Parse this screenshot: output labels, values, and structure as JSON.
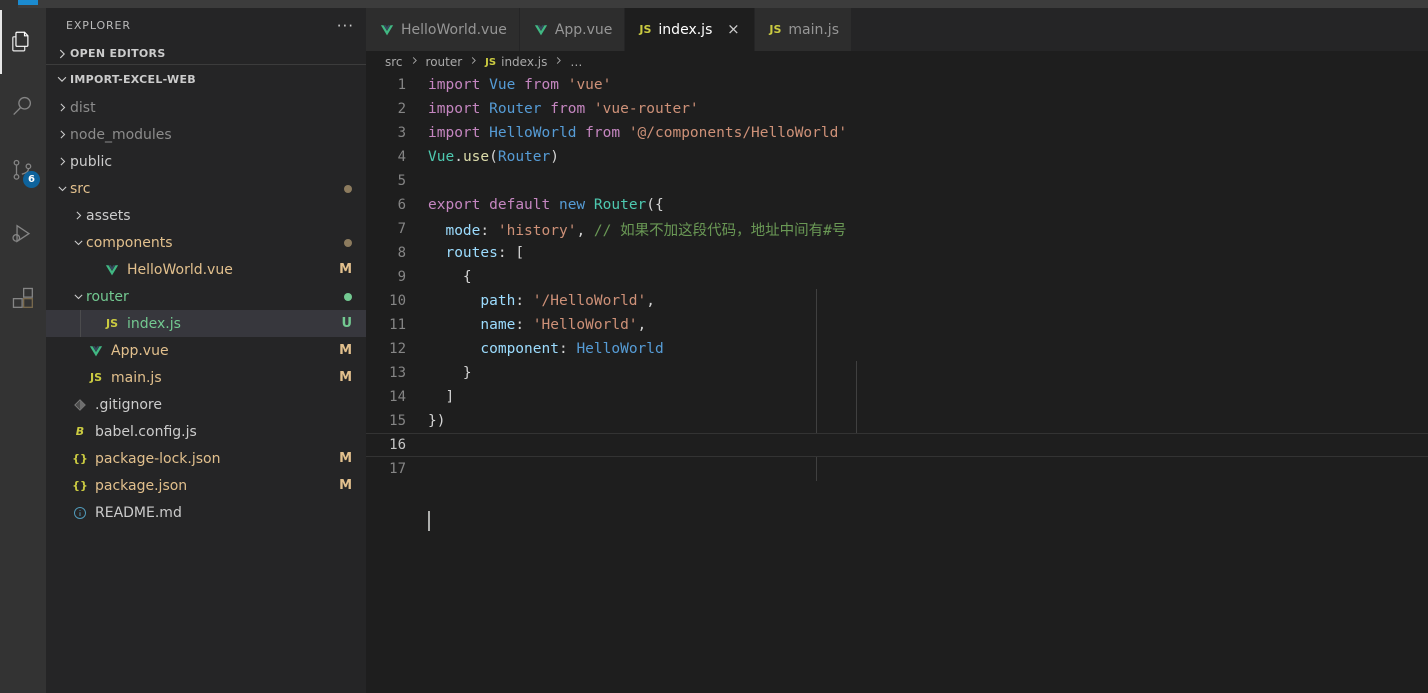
{
  "window": {
    "accent_color": "#1b8bd0",
    "chrome_bg": "#3c3c3c"
  },
  "activity_bar": {
    "items": [
      {
        "name": "explorer-icon",
        "label": "Explorer",
        "active": true,
        "badge": ""
      },
      {
        "name": "search-icon",
        "label": "Search",
        "active": false,
        "badge": ""
      },
      {
        "name": "source-control-icon",
        "label": "Source Control",
        "active": false,
        "badge": "6"
      },
      {
        "name": "run-and-debug-icon",
        "label": "Run and Debug",
        "active": false,
        "badge": ""
      },
      {
        "name": "extensions-icon",
        "label": "Extensions",
        "active": false,
        "badge": ""
      }
    ]
  },
  "sidebar": {
    "title": "EXPLORER",
    "more_actions": "···",
    "sections": [
      {
        "label": "OPEN EDITORS",
        "expanded": false
      },
      {
        "label": "IMPORT-EXCEL-WEB",
        "expanded": true
      }
    ],
    "tree": [
      {
        "label": "dist",
        "depth": 1,
        "type": "folder",
        "expanded": false,
        "deco": "",
        "dot": "",
        "color": "#8c8c8c",
        "icon": ""
      },
      {
        "label": "node_modules",
        "depth": 1,
        "type": "folder",
        "expanded": false,
        "deco": "",
        "dot": "",
        "color": "#8c8c8c",
        "icon": ""
      },
      {
        "label": "public",
        "depth": 1,
        "type": "folder",
        "expanded": false,
        "deco": "",
        "dot": "",
        "color": "#cccccc",
        "icon": ""
      },
      {
        "label": "src",
        "depth": 1,
        "type": "folder",
        "expanded": true,
        "deco": "",
        "dot": "#8c7b5e",
        "color": "#e2c08d",
        "icon": ""
      },
      {
        "label": "assets",
        "depth": 2,
        "type": "folder",
        "expanded": false,
        "deco": "",
        "dot": "",
        "color": "#cccccc",
        "icon": ""
      },
      {
        "label": "components",
        "depth": 2,
        "type": "folder",
        "expanded": true,
        "deco": "",
        "dot": "#8c7b5e",
        "color": "#e2c08d",
        "icon": ""
      },
      {
        "label": "HelloWorld.vue",
        "depth": 3,
        "type": "file",
        "expanded": false,
        "deco": "M",
        "dot": "",
        "color": "#e2c08d",
        "icon": "vue"
      },
      {
        "label": "router",
        "depth": 2,
        "type": "folder",
        "expanded": true,
        "deco": "",
        "dot": "#73c991",
        "color": "#73c991",
        "icon": ""
      },
      {
        "label": "index.js",
        "depth": 3,
        "type": "file",
        "expanded": false,
        "deco": "U",
        "dot": "",
        "color": "#73c991",
        "icon": "js",
        "selected": true
      },
      {
        "label": "App.vue",
        "depth": 2,
        "type": "file",
        "expanded": false,
        "deco": "M",
        "dot": "",
        "color": "#e2c08d",
        "icon": "vue"
      },
      {
        "label": "main.js",
        "depth": 2,
        "type": "file",
        "expanded": false,
        "deco": "M",
        "dot": "",
        "color": "#e2c08d",
        "icon": "js"
      },
      {
        "label": ".gitignore",
        "depth": 1,
        "type": "file",
        "expanded": false,
        "deco": "",
        "dot": "",
        "color": "#cccccc",
        "icon": "git"
      },
      {
        "label": "babel.config.js",
        "depth": 1,
        "type": "file",
        "expanded": false,
        "deco": "",
        "dot": "",
        "color": "#cccccc",
        "icon": "babel"
      },
      {
        "label": "package-lock.json",
        "depth": 1,
        "type": "file",
        "expanded": false,
        "deco": "M",
        "dot": "",
        "color": "#e2c08d",
        "icon": "json"
      },
      {
        "label": "package.json",
        "depth": 1,
        "type": "file",
        "expanded": false,
        "deco": "M",
        "dot": "",
        "color": "#e2c08d",
        "icon": "json"
      },
      {
        "label": "README.md",
        "depth": 1,
        "type": "file",
        "expanded": false,
        "deco": "",
        "dot": "",
        "color": "#cccccc",
        "icon": "md"
      }
    ]
  },
  "tabs": [
    {
      "label": "HelloWorld.vue",
      "icon": "vue",
      "active": false,
      "dirty": false
    },
    {
      "label": "App.vue",
      "icon": "vue",
      "active": false,
      "dirty": false
    },
    {
      "label": "index.js",
      "icon": "js",
      "active": true,
      "dirty": false,
      "close": "×"
    },
    {
      "label": "main.js",
      "icon": "js",
      "active": false,
      "dirty": false
    }
  ],
  "breadcrumbs": [
    {
      "label": "src",
      "icon": ""
    },
    {
      "label": "router",
      "icon": ""
    },
    {
      "label": "index.js",
      "icon": "js"
    },
    {
      "label": "…",
      "icon": ""
    }
  ],
  "editor": {
    "current_line": 16,
    "total_lines": 17,
    "lines": [
      {
        "n": "1",
        "tokens": [
          {
            "t": "import",
            "c": "t-kw"
          },
          {
            "t": " ",
            "c": "t-pl"
          },
          {
            "t": "Vue",
            "c": "t-key"
          },
          {
            "t": " ",
            "c": "t-pl"
          },
          {
            "t": "from",
            "c": "t-kw"
          },
          {
            "t": " ",
            "c": "t-pl"
          },
          {
            "t": "'vue'",
            "c": "t-str"
          }
        ]
      },
      {
        "n": "2",
        "tokens": [
          {
            "t": "import",
            "c": "t-kw"
          },
          {
            "t": " ",
            "c": "t-pl"
          },
          {
            "t": "Router",
            "c": "t-key"
          },
          {
            "t": " ",
            "c": "t-pl"
          },
          {
            "t": "from",
            "c": "t-kw"
          },
          {
            "t": " ",
            "c": "t-pl"
          },
          {
            "t": "'vue-router'",
            "c": "t-str"
          }
        ]
      },
      {
        "n": "3",
        "tokens": [
          {
            "t": "import",
            "c": "t-kw"
          },
          {
            "t": " ",
            "c": "t-pl"
          },
          {
            "t": "HelloWorld",
            "c": "t-key"
          },
          {
            "t": " ",
            "c": "t-pl"
          },
          {
            "t": "from",
            "c": "t-kw"
          },
          {
            "t": " ",
            "c": "t-pl"
          },
          {
            "t": "'@/components/HelloWorld'",
            "c": "t-str"
          }
        ]
      },
      {
        "n": "4",
        "tokens": [
          {
            "t": "Vue",
            "c": "t-cls"
          },
          {
            "t": ".",
            "c": "t-pl"
          },
          {
            "t": "use",
            "c": "t-fn"
          },
          {
            "t": "(",
            "c": "t-pl"
          },
          {
            "t": "Router",
            "c": "t-key"
          },
          {
            "t": ")",
            "c": "t-pl"
          }
        ]
      },
      {
        "n": "5",
        "tokens": []
      },
      {
        "n": "6",
        "tokens": [
          {
            "t": "export",
            "c": "t-kw"
          },
          {
            "t": " ",
            "c": "t-pl"
          },
          {
            "t": "default",
            "c": "t-kw"
          },
          {
            "t": " ",
            "c": "t-pl"
          },
          {
            "t": "new",
            "c": "t-key"
          },
          {
            "t": " ",
            "c": "t-pl"
          },
          {
            "t": "Router",
            "c": "t-cls"
          },
          {
            "t": "({",
            "c": "t-pl"
          }
        ]
      },
      {
        "n": "7",
        "tokens": [
          {
            "t": "  ",
            "c": "t-pl"
          },
          {
            "t": "mode",
            "c": "t-var"
          },
          {
            "t": ": ",
            "c": "t-pl"
          },
          {
            "t": "'history'",
            "c": "t-str"
          },
          {
            "t": ", ",
            "c": "t-pl"
          },
          {
            "t": "// 如果不加这段代码，地址中间有#号",
            "c": "t-cmt"
          }
        ]
      },
      {
        "n": "8",
        "tokens": [
          {
            "t": "  ",
            "c": "t-pl"
          },
          {
            "t": "routes",
            "c": "t-var"
          },
          {
            "t": ": [",
            "c": "t-pl"
          }
        ]
      },
      {
        "n": "9",
        "tokens": [
          {
            "t": "    {",
            "c": "t-pl"
          }
        ]
      },
      {
        "n": "10",
        "tokens": [
          {
            "t": "      ",
            "c": "t-pl"
          },
          {
            "t": "path",
            "c": "t-var"
          },
          {
            "t": ": ",
            "c": "t-pl"
          },
          {
            "t": "'/HelloWorld'",
            "c": "t-str"
          },
          {
            "t": ",",
            "c": "t-pl"
          }
        ]
      },
      {
        "n": "11",
        "tokens": [
          {
            "t": "      ",
            "c": "t-pl"
          },
          {
            "t": "name",
            "c": "t-var"
          },
          {
            "t": ": ",
            "c": "t-pl"
          },
          {
            "t": "'HelloWorld'",
            "c": "t-str"
          },
          {
            "t": ",",
            "c": "t-pl"
          }
        ]
      },
      {
        "n": "12",
        "tokens": [
          {
            "t": "      ",
            "c": "t-pl"
          },
          {
            "t": "component",
            "c": "t-var"
          },
          {
            "t": ": ",
            "c": "t-pl"
          },
          {
            "t": "HelloWorld",
            "c": "t-key"
          }
        ]
      },
      {
        "n": "13",
        "tokens": [
          {
            "t": "    }",
            "c": "t-pl"
          }
        ]
      },
      {
        "n": "14",
        "tokens": [
          {
            "t": "  ]",
            "c": "t-pl"
          }
        ]
      },
      {
        "n": "15",
        "tokens": [
          {
            "t": "})",
            "c": "t-pl"
          }
        ]
      },
      {
        "n": "16",
        "tokens": [],
        "current": true
      },
      {
        "n": "17",
        "tokens": []
      }
    ]
  }
}
